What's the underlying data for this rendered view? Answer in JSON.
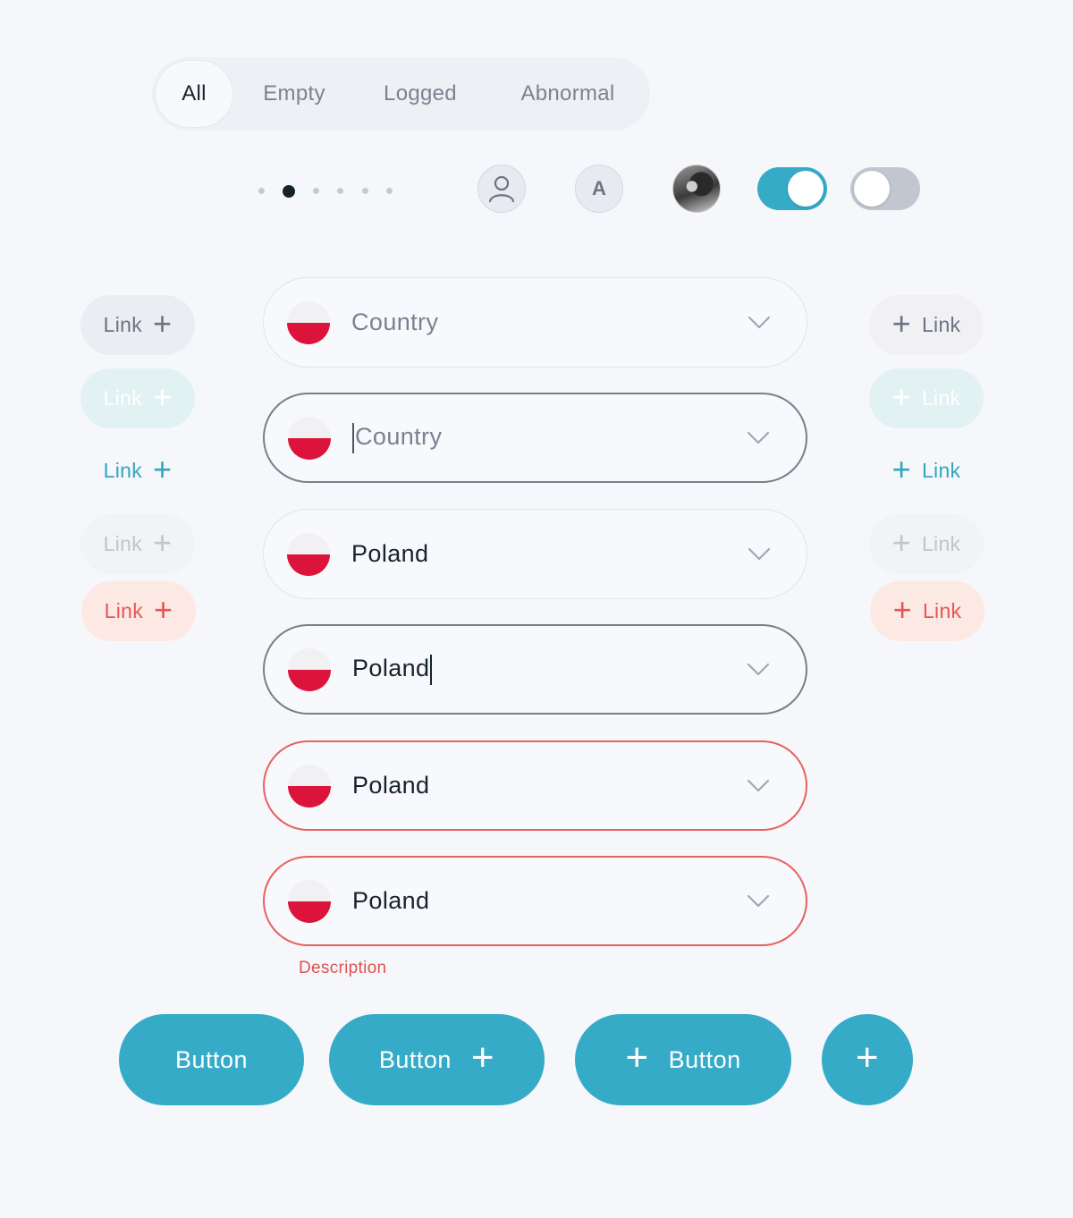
{
  "tabs": [
    {
      "label": "All",
      "active": true
    },
    {
      "label": "Empty",
      "active": false
    },
    {
      "label": "Logged",
      "active": false
    },
    {
      "label": "Abnormal",
      "active": false
    }
  ],
  "pagination": {
    "count": 6,
    "active_index": 1
  },
  "avatars": {
    "letter": "A"
  },
  "toggles": [
    {
      "state": "on"
    },
    {
      "state": "off"
    }
  ],
  "links_left": [
    {
      "label": "Link",
      "icon": "plus-icon",
      "style": "default"
    },
    {
      "label": "Link",
      "icon": "plus-icon",
      "style": "hover"
    },
    {
      "label": "Link",
      "icon": "plus-icon",
      "style": "ghost"
    },
    {
      "label": "Link",
      "icon": "plus-icon",
      "style": "disabled"
    },
    {
      "label": "Link",
      "icon": "plus-icon",
      "style": "danger"
    }
  ],
  "links_right": [
    {
      "label": "Link",
      "icon": "plus-icon",
      "style": "default"
    },
    {
      "label": "Link",
      "icon": "plus-icon",
      "style": "hover"
    },
    {
      "label": "Link",
      "icon": "plus-icon",
      "style": "ghost"
    },
    {
      "label": "Link",
      "icon": "plus-icon",
      "style": "disabled"
    },
    {
      "label": "Link",
      "icon": "plus-icon",
      "style": "danger"
    }
  ],
  "fields": [
    {
      "text": "Country",
      "kind": "placeholder",
      "state": "default"
    },
    {
      "text": "Country",
      "kind": "placeholder",
      "state": "focused"
    },
    {
      "text": "Poland",
      "kind": "value",
      "state": "default"
    },
    {
      "text": "Poland",
      "kind": "value",
      "state": "focused"
    },
    {
      "text": "Poland",
      "kind": "value",
      "state": "error"
    },
    {
      "text": "Poland",
      "kind": "value",
      "state": "error"
    }
  ],
  "field_description": "Description",
  "buttons": [
    {
      "label": "Button",
      "icon": "none"
    },
    {
      "label": "Button",
      "icon": "plus-icon-right"
    },
    {
      "label": "Button",
      "icon": "plus-icon-left"
    },
    {
      "label": "",
      "icon": "plus-icon"
    }
  ],
  "colors": {
    "primary": "#36abc7",
    "danger": "#e65656",
    "text": "#17232b",
    "muted": "#7d8190",
    "flag_red": "#dc143c"
  }
}
